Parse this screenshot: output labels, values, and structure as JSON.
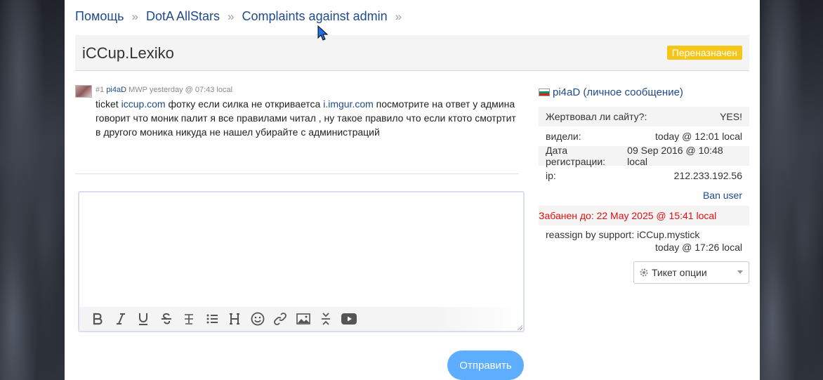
{
  "breadcrumb": {
    "items": [
      "Помощь",
      "DotA AllStars",
      "Complaints against admin"
    ],
    "separator": "»"
  },
  "ticket": {
    "title": "iCCup.Lexiko",
    "status": "Переназначен"
  },
  "post": {
    "number": "#1",
    "author": "pi4aD",
    "rank": "MWP",
    "time": "yesterday @ 07:43 local",
    "text_1": "ticket ",
    "link_1": "iccup.com",
    "text_2": " фотку если силка не откриваетса ",
    "link_2": "i.imgur.com",
    "text_3": " посмотрите на ответ у админа говорит что моник палит я все правилами читал , ну такое правило что если ктото смотртит в другого моника никуда не нашел убирайте с администраций"
  },
  "editor": {
    "toolbar_icons": [
      "bold-icon",
      "italic-icon",
      "underline-icon",
      "strikethrough-icon",
      "clear-format-icon",
      "list-icon",
      "heading-icon",
      "emoji-icon",
      "link-icon",
      "image-icon",
      "spoiler-icon",
      "youtube-icon"
    ]
  },
  "send_label": "Отправить",
  "sidebar": {
    "user": "pi4aD",
    "pm_label": "(личное сообщение)",
    "rows": [
      {
        "label": "Жертвовал ли сайту?:",
        "value": "YES!"
      },
      {
        "label": "видели:",
        "value": "today @ 12:01 local"
      },
      {
        "label": "Дата регистрации:",
        "value": "09 Sep 2016 @ 10:48 local"
      },
      {
        "label": "ip:",
        "value": "212.233.192.56"
      }
    ],
    "ban_user": "Ban user",
    "banned_until": "Забанен до: 22 May 2025 @ 15:41 local",
    "reassign": "reassign by support: iCCup.mystick",
    "reassign_time": "today @ 17:26 local",
    "ticket_options": "Тикет опции"
  },
  "colors": {
    "link": "#1f4a8c",
    "badge": "#f5c518",
    "send_button": "#5daeff",
    "banned_text": "#e01010"
  }
}
